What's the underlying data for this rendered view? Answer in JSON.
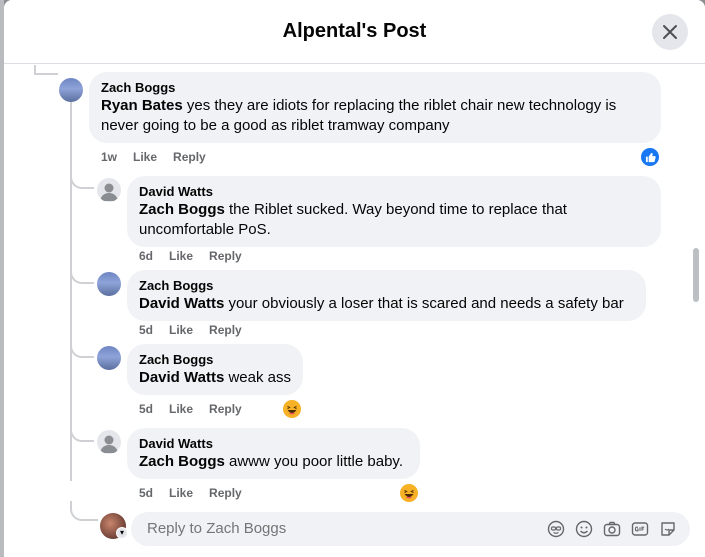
{
  "modal": {
    "title": "Alpental's Post",
    "close_label": "Close"
  },
  "comments": [
    {
      "author": "Zach Boggs",
      "mention": "Ryan Bates",
      "text": " yes they are idiots for replacing the riblet chair new technology is never going to be a good as riblet tramway company",
      "time": "1w",
      "like": "Like",
      "reply": "Reply",
      "reaction": "like"
    },
    {
      "author": "David Watts",
      "mention": "Zach Boggs",
      "text": " the Riblet sucked. Way beyond time to replace that uncomfortable PoS.",
      "time": "6d",
      "like": "Like",
      "reply": "Reply"
    },
    {
      "author": "Zach Boggs",
      "mention": "David Watts",
      "text": " your obviously a loser that is scared and needs a safety bar",
      "time": "5d",
      "like": "Like",
      "reply": "Reply"
    },
    {
      "author": "Zach Boggs",
      "mention": "David Watts",
      "text": " weak ass",
      "time": "5d",
      "like": "Like",
      "reply": "Reply",
      "reaction": "haha"
    },
    {
      "author": "David Watts",
      "mention": "Zach Boggs",
      "text": " awww you poor little baby.",
      "time": "5d",
      "like": "Like",
      "reply": "Reply",
      "reaction": "haha"
    }
  ],
  "reply_box": {
    "placeholder": "Reply to Zach Boggs",
    "icons": [
      "avatar-sticker-icon",
      "emoji-icon",
      "camera-icon",
      "gif-icon",
      "sticker-icon"
    ]
  },
  "colors": {
    "accent": "#1877f2",
    "bubble": "#f0f2f5",
    "meta": "#65676b"
  }
}
